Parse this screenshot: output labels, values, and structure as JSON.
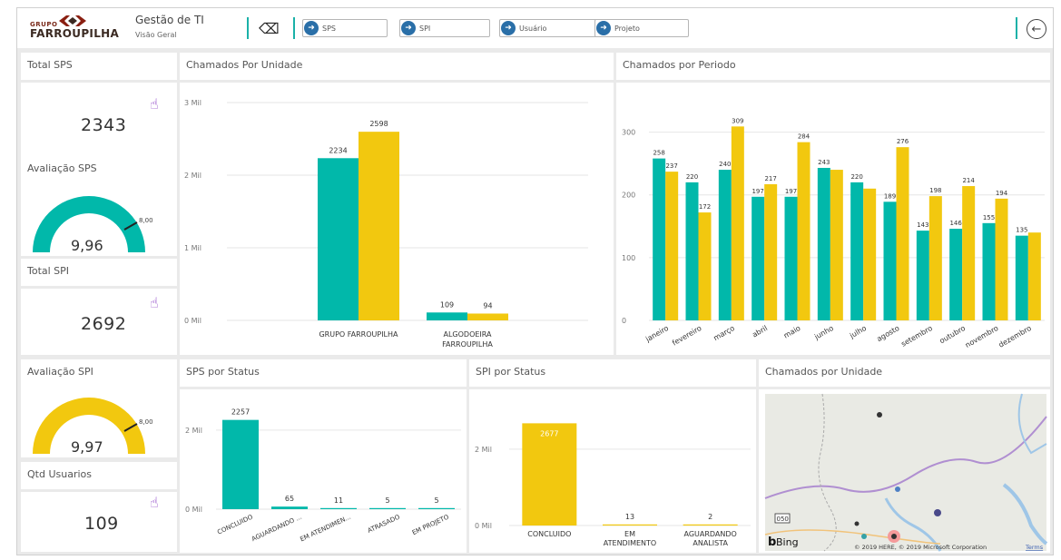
{
  "header": {
    "logo_small": "GRUPO",
    "logo_big": "FARROUPILHA",
    "title": "Gestão de TI",
    "subtitle": "Visão Geral",
    "nav_buttons": [
      "SPS",
      "SPI",
      "Usuário",
      "Projeto"
    ]
  },
  "kpis": {
    "total_sps": {
      "title": "Total SPS",
      "value": "2343"
    },
    "avaliacao_sps": {
      "title": "Avaliação SPS",
      "value": "9,96",
      "target": "8,00"
    },
    "total_spi": {
      "title": "Total SPI",
      "value": "2692"
    },
    "avaliacao_spi": {
      "title": "Avaliação SPI",
      "value": "9,97",
      "target": "8,00"
    },
    "qtd_usuarios": {
      "title": "Qtd Usuarios",
      "value": "109"
    }
  },
  "panels": {
    "chamados_unidade": "Chamados Por Unidade",
    "chamados_periodo": "Chamados por Periodo",
    "sps_status": "SPS por Status",
    "spi_status": "SPI por Status",
    "mapa": "Chamados por Unidade"
  },
  "colors": {
    "teal": "#01b8aa",
    "yellow": "#f2c80f",
    "nav_arrow": "#2a6fa8"
  },
  "map": {
    "bing": "Bing",
    "copyright": "© 2019 HERE, © 2019 Microsoft Corporation",
    "terms": "Terms",
    "road": "050"
  },
  "chart_data": [
    {
      "type": "bar",
      "title": "Chamados Por Unidade",
      "categories": [
        "GRUPO FARROUPILHA",
        "ALGODOEIRA FARROUPILHA"
      ],
      "series": [
        {
          "values": [
            2234,
            109
          ]
        },
        {
          "values": [
            2598,
            94
          ]
        }
      ],
      "ylim": [
        0,
        3000
      ],
      "yticks": [
        "0 Mil",
        "1 Mil",
        "2 Mil",
        "3 Mil"
      ]
    },
    {
      "type": "bar",
      "title": "Chamados por Periodo",
      "categories": [
        "janeiro",
        "fevereiro",
        "março",
        "abril",
        "maio",
        "junho",
        "julho",
        "agosto",
        "setembro",
        "outubro",
        "novembro",
        "dezembro"
      ],
      "series": [
        {
          "values": [
            258,
            220,
            240,
            197,
            197,
            243,
            220,
            189,
            143,
            146,
            155,
            135
          ]
        },
        {
          "values": [
            237,
            172,
            309,
            217,
            284,
            240,
            210,
            276,
            198,
            214,
            194,
            140
          ]
        }
      ],
      "labels_a": [
        "258",
        "220",
        "240",
        "197",
        "197",
        "243",
        "220",
        "189",
        "143",
        "146",
        "155",
        "135"
      ],
      "labels_b": [
        "237",
        "172",
        "309",
        "217",
        "284",
        "",
        "",
        "276",
        "198",
        "214",
        "194",
        ""
      ],
      "ylim": [
        0,
        350
      ],
      "yticks": [
        "0",
        "100",
        "200",
        "300"
      ]
    },
    {
      "type": "bar",
      "title": "SPS por Status",
      "categories": [
        "CONCLUIDO",
        "AGUARDANDO ...",
        "EM ATENDIMEN...",
        "ATRASADO",
        "EM PROJETO"
      ],
      "values": [
        2257,
        65,
        11,
        5,
        5
      ],
      "ylim": [
        0,
        2800
      ],
      "yticks": [
        "0 Mil",
        "2 Mil"
      ]
    },
    {
      "type": "bar",
      "title": "SPI por Status",
      "categories": [
        "CONCLUIDO",
        "EM ATENDIMENTO",
        "AGUARDANDO ANALISTA"
      ],
      "values": [
        2677,
        13,
        2
      ],
      "ylim": [
        0,
        2900
      ],
      "yticks": [
        "0 Mil",
        "2 Mil"
      ]
    }
  ]
}
